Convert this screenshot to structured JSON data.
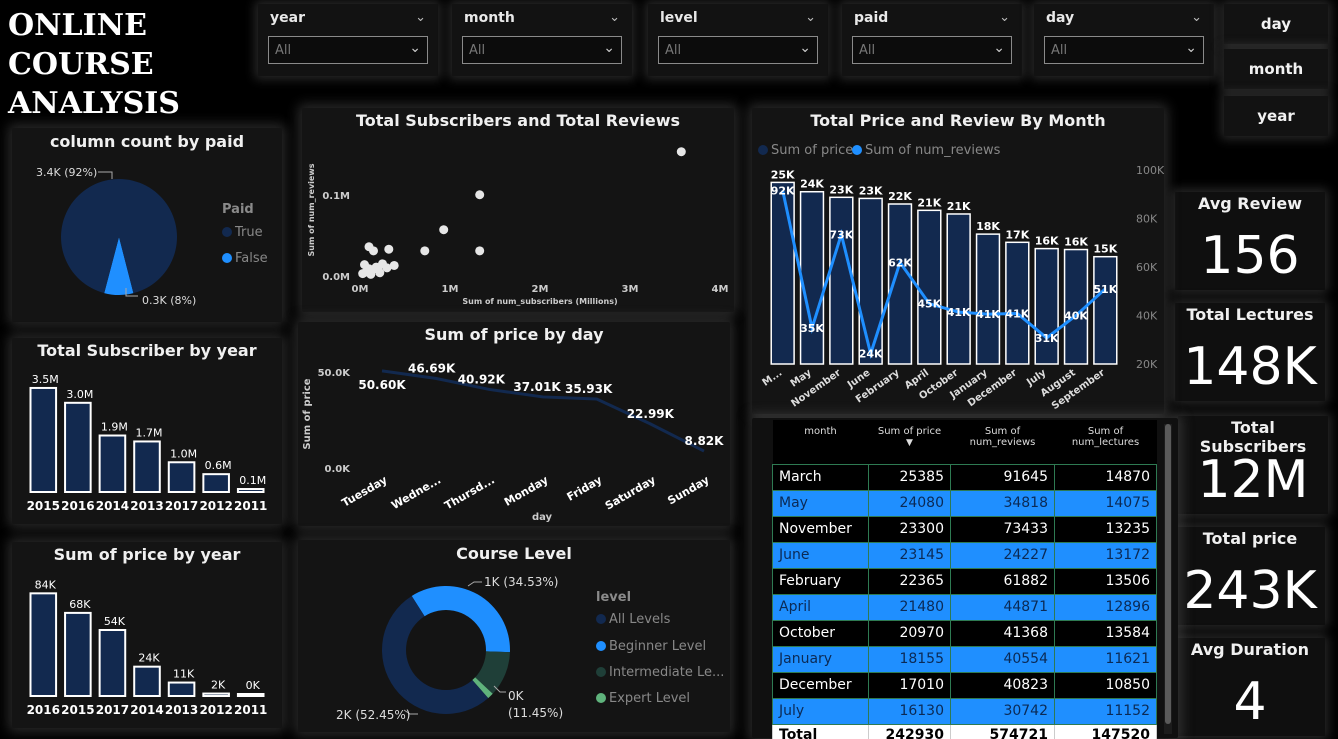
{
  "title": {
    "line1": "ONLINE",
    "line2": "COURSE",
    "line3": "ANALYSIS"
  },
  "slicers": [
    {
      "label": "year",
      "value": "All"
    },
    {
      "label": "month",
      "value": "All"
    },
    {
      "label": "level",
      "value": "All"
    },
    {
      "label": "paid",
      "value": "All"
    },
    {
      "label": "day",
      "value": "All"
    }
  ],
  "nav": {
    "day": "day",
    "month": "month",
    "year": "year"
  },
  "kpis": [
    {
      "label": "Avg Review",
      "value": "156"
    },
    {
      "label": "Total Lectures",
      "value": "148K"
    },
    {
      "label": "Total Subscribers",
      "value": "12M"
    },
    {
      "label": "Total price",
      "value": "243K"
    },
    {
      "label": "Avg Duration",
      "value": "4"
    }
  ],
  "colors": {
    "dark_blue": "#12294f",
    "bright_blue": "#1f8fff",
    "teal": "#1f3f38",
    "green": "#5fb37c",
    "bar_outline": "#ffffff"
  },
  "chart_data": [
    {
      "type": "pie",
      "title": "column count by paid",
      "legend_title": "Paid",
      "legend_position": "right",
      "slices": [
        {
          "name": "True",
          "value": 3400,
          "label": "3.4K (92%)",
          "color": "#12294f"
        },
        {
          "name": "False",
          "value": 300,
          "label": "0.3K (8%)",
          "color": "#1f8fff"
        }
      ]
    },
    {
      "type": "scatter",
      "title": "Total Subscribers and Total Reviews",
      "xlabel": "Sum of num_subscribers (Millions)",
      "ylabel": "Sum of num_reviews",
      "x_ticks": [
        "0M",
        "1M",
        "2M",
        "3M",
        "4M"
      ],
      "y_ticks": [
        "0.0M",
        "0.1M"
      ],
      "xlim": [
        0,
        4
      ],
      "ylim": [
        0,
        0.16
      ],
      "points": [
        [
          3.57,
          0.153
        ],
        [
          1.33,
          0.1
        ],
        [
          0.93,
          0.057
        ],
        [
          1.33,
          0.031
        ],
        [
          0.72,
          0.031
        ],
        [
          0.1,
          0.036
        ],
        [
          0.15,
          0.031
        ],
        [
          0.32,
          0.033
        ],
        [
          0.38,
          0.013
        ],
        [
          0.05,
          0.014
        ],
        [
          0.1,
          0.009
        ],
        [
          0.18,
          0.011
        ],
        [
          0.25,
          0.015
        ],
        [
          0.07,
          0.005
        ],
        [
          0.13,
          0.007
        ],
        [
          0.2,
          0.008
        ],
        [
          0.3,
          0.01
        ],
        [
          0.03,
          0.003
        ],
        [
          0.22,
          0.004
        ],
        [
          0.12,
          0.002
        ]
      ]
    },
    {
      "type": "bar",
      "title": "Total Price and Review By Month",
      "legend_position": "top-left",
      "categories": [
        "M...",
        "May",
        "November",
        "June",
        "February",
        "April",
        "October",
        "January",
        "December",
        "July",
        "August",
        "September"
      ],
      "series": [
        {
          "name": "Sum of price",
          "values": [
            25385,
            24080,
            23300,
            23145,
            22365,
            21480,
            20970,
            18155,
            17010,
            16130,
            16000,
            15000
          ],
          "labels": [
            "25K",
            "24K",
            "23K",
            "23K",
            "22K",
            "21K",
            "21K",
            "18K",
            "17K",
            "16K",
            "16K",
            "15K"
          ]
        },
        {
          "name": "Sum of num_reviews",
          "values": [
            91645,
            34818,
            73433,
            24227,
            61882,
            44871,
            41368,
            40554,
            40823,
            30742,
            40000,
            51000
          ],
          "labels": [
            "92K",
            "35K",
            "73K",
            "24K",
            "62K",
            "45K",
            "41K",
            "41K",
            "41K",
            "31K",
            "40K",
            "51K"
          ]
        }
      ],
      "y2_ticks": [
        "20K",
        "40K",
        "60K",
        "80K",
        "100K"
      ],
      "y2lim": [
        20000,
        100000
      ]
    },
    {
      "type": "bar",
      "title": "Total Subscriber by year",
      "categories": [
        "2015",
        "2016",
        "2014",
        "2013",
        "2017",
        "2012",
        "2011"
      ],
      "values": [
        3.5,
        3.0,
        1.9,
        1.7,
        1.0,
        0.6,
        0.1
      ],
      "labels": [
        "3.5M",
        "3.0M",
        "1.9M",
        "1.7M",
        "1.0M",
        "0.6M",
        "0.1M"
      ]
    },
    {
      "type": "line",
      "title": "Sum of price by day",
      "xlabel": "day",
      "ylabel": "Sum of price",
      "categories": [
        "Tuesday",
        "Wedne...",
        "Thursd...",
        "Monday",
        "Friday",
        "Saturday",
        "Sunday"
      ],
      "values": [
        50600,
        46690,
        40920,
        37010,
        35930,
        22990,
        8820
      ],
      "labels": [
        "50.60K",
        "46.69K",
        "40.92K",
        "37.01K",
        "35.93K",
        "22.99K",
        "8.82K"
      ],
      "y_ticks": [
        "0.0K",
        "50.0K"
      ],
      "ylim": [
        0,
        50000
      ]
    },
    {
      "type": "bar",
      "title": "Sum of price by year",
      "categories": [
        "2016",
        "2015",
        "2017",
        "2014",
        "2013",
        "2012",
        "2011"
      ],
      "values": [
        84,
        68,
        54,
        24,
        11,
        2,
        0
      ],
      "labels": [
        "84K",
        "68K",
        "54K",
        "24K",
        "11K",
        "2K",
        "0K"
      ]
    },
    {
      "type": "pie",
      "title": "Course Level",
      "legend_title": "level",
      "legend_position": "right",
      "donut": true,
      "slices": [
        {
          "name": "All Levels",
          "value": 52.45,
          "label": "2K (52.45%)",
          "color": "#12294f"
        },
        {
          "name": "Beginner Level",
          "value": 34.53,
          "label": "1K (34.53%)",
          "color": "#1f8fff"
        },
        {
          "name": "Intermediate Le...",
          "value": 11.45,
          "label": "0K\n(11.45%)",
          "color": "#1f3f38"
        },
        {
          "name": "Expert Level",
          "value": 1.57,
          "label": "",
          "color": "#5fb37c"
        }
      ]
    }
  ],
  "table": {
    "headers": [
      "month",
      "Sum of price",
      "Sum of num_reviews",
      "Sum of num_lectures"
    ],
    "rows": [
      [
        "March",
        "25385",
        "91645",
        "14870"
      ],
      [
        "May",
        "24080",
        "34818",
        "14075"
      ],
      [
        "November",
        "23300",
        "73433",
        "13235"
      ],
      [
        "June",
        "23145",
        "24227",
        "13172"
      ],
      [
        "February",
        "22365",
        "61882",
        "13506"
      ],
      [
        "April",
        "21480",
        "44871",
        "12896"
      ],
      [
        "October",
        "20970",
        "41368",
        "13584"
      ],
      [
        "January",
        "18155",
        "40554",
        "11621"
      ],
      [
        "December",
        "17010",
        "40823",
        "10850"
      ],
      [
        "July",
        "16130",
        "30742",
        "11152"
      ]
    ],
    "total": [
      "Total",
      "242930",
      "574721",
      "147520"
    ]
  }
}
